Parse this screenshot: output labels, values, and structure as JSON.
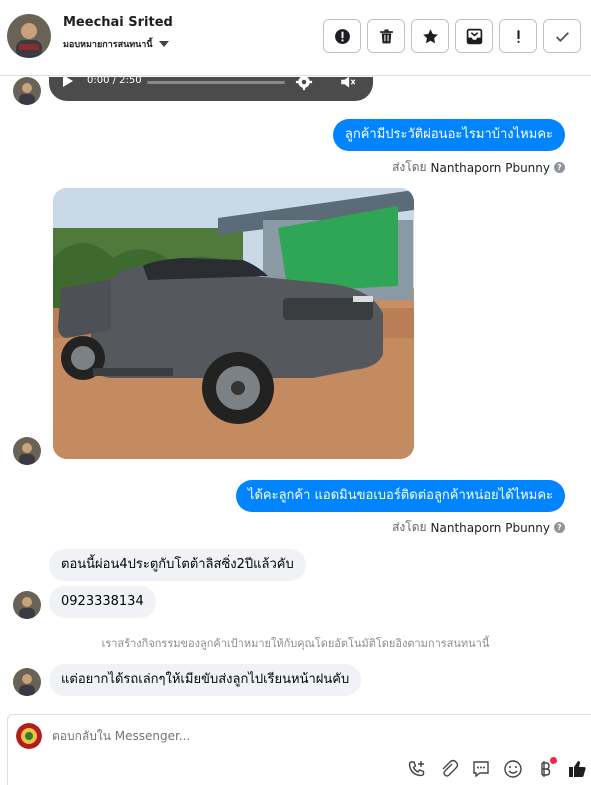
{
  "header": {
    "name": "Meechai Srited",
    "subtitle": "มอบหมายการสนทนานี้",
    "toolbar": [
      {
        "icon": "alert-circle-icon",
        "name": "mark-spam-button"
      },
      {
        "icon": "trash-icon",
        "name": "delete-button"
      },
      {
        "icon": "star-icon",
        "name": "star-button"
      },
      {
        "icon": "archive-icon",
        "name": "move-to-done-button"
      },
      {
        "icon": "exclamation-icon",
        "name": "follow-up-button"
      },
      {
        "icon": "check-icon",
        "name": "mark-done-button"
      }
    ]
  },
  "audio": {
    "time": "0:00 / 2:50"
  },
  "messages": {
    "m1": "ลูกค้ามีประวัติผ่อนอะไรมาบ้างไหมคะ",
    "m2": "ได้คะลูกค้า แอดมินขอเบอร์ติดต่อลูกค้าหน่อยได้ไหมคะ",
    "m3": "ตอนนี้ผ่อน4ประตูกับโตต้าลิสซิ่ง2ปีแล้วคับ",
    "m4": "0923338134",
    "m5": "แต่อยากได้รถเล่กๆให้เมียขับส่งลูกไปเรียนหน้าฝนคับ"
  },
  "sent_by": {
    "label": "ส่งโดย",
    "name": "Nanthaporn Pbunny",
    "help": "?"
  },
  "system_note": "เราสร้างกิจกรรมของลูกค้าเป้าหมายให้กับคุณโดยอัตโนมัติโดยอิงตามการสนทนานี้",
  "composer": {
    "placeholder": "ตอบกลับใน Messenger..."
  },
  "colors": {
    "outgoing_bubble": "#0084ff",
    "incoming_bubble": "#f0f2f5",
    "alert_dot": "#f02849"
  }
}
